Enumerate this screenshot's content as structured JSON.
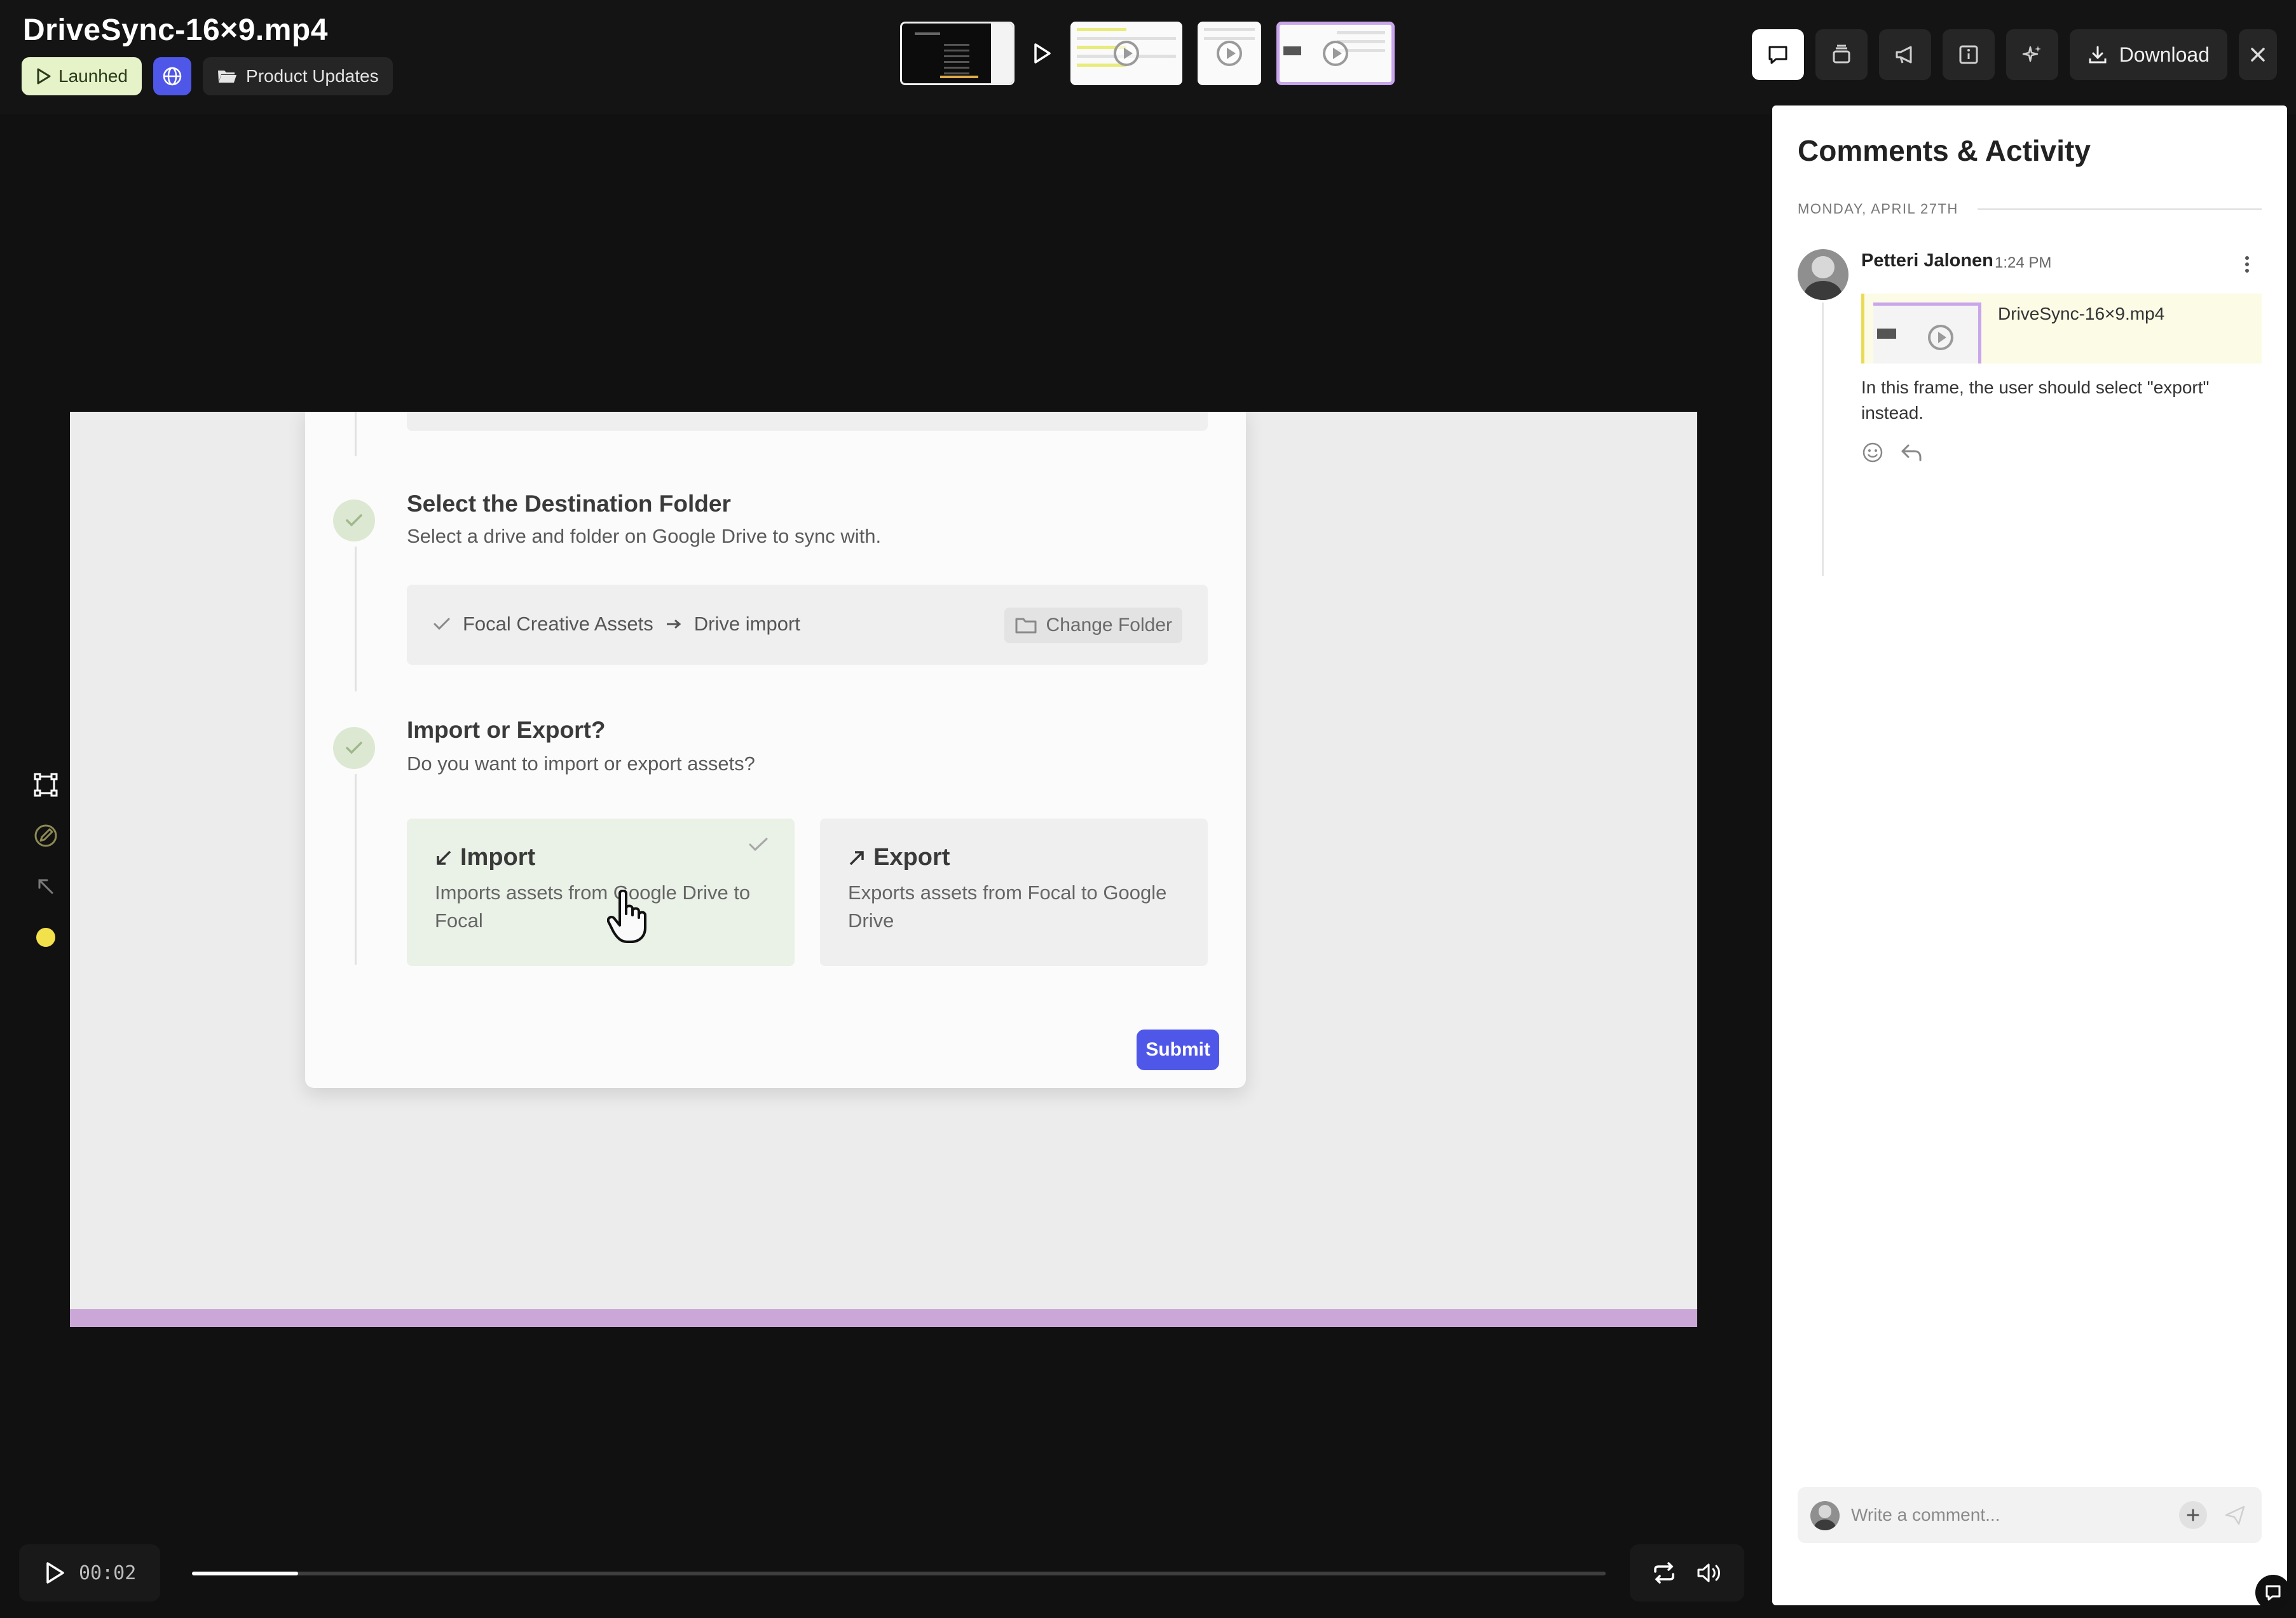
{
  "header": {
    "title": "DriveSync-16×9.mp4",
    "status_label": "Launhed",
    "folder_label": "Product Updates"
  },
  "toolbar": {
    "download_label": "Download",
    "icons": [
      "comment-icon",
      "stack-icon",
      "megaphone-icon",
      "info-icon",
      "sparkle-icon",
      "download-icon",
      "close-icon"
    ]
  },
  "colors": {
    "accent": "#4f57e8",
    "status_chip": "#e6f2c8",
    "selected_thumb": "#c9a6ec",
    "draw_color": "#f2e14a"
  },
  "video": {
    "steps": [
      {
        "title": "Select the Destination Folder",
        "subtitle": "Select a drive and folder on Google Drive to sync with."
      },
      {
        "title": "Import or Export?",
        "subtitle": "Do you want to import or export assets?"
      }
    ],
    "folder_path": {
      "source": "Focal Creative Assets",
      "target": "Drive import",
      "change_label": "Change Folder"
    },
    "options": {
      "import_title": "Import",
      "import_desc": "Imports assets from Google Drive to Focal",
      "export_title": "Export",
      "export_desc": "Exports assets from Focal to Google Drive"
    },
    "submit_label": "Submit"
  },
  "player": {
    "current_time": "00:02",
    "progress": 0.075
  },
  "comments": {
    "title": "Comments & Activity",
    "date_label": "MONDAY, APRIL 27TH",
    "items": [
      {
        "author": "Petteri Jalonen",
        "time": "1:24 PM",
        "attachment": "DriveSync-16×9.mp4",
        "text": "In this frame, the user should select \"export\" instead."
      }
    ],
    "composer_placeholder": "Write a comment..."
  }
}
